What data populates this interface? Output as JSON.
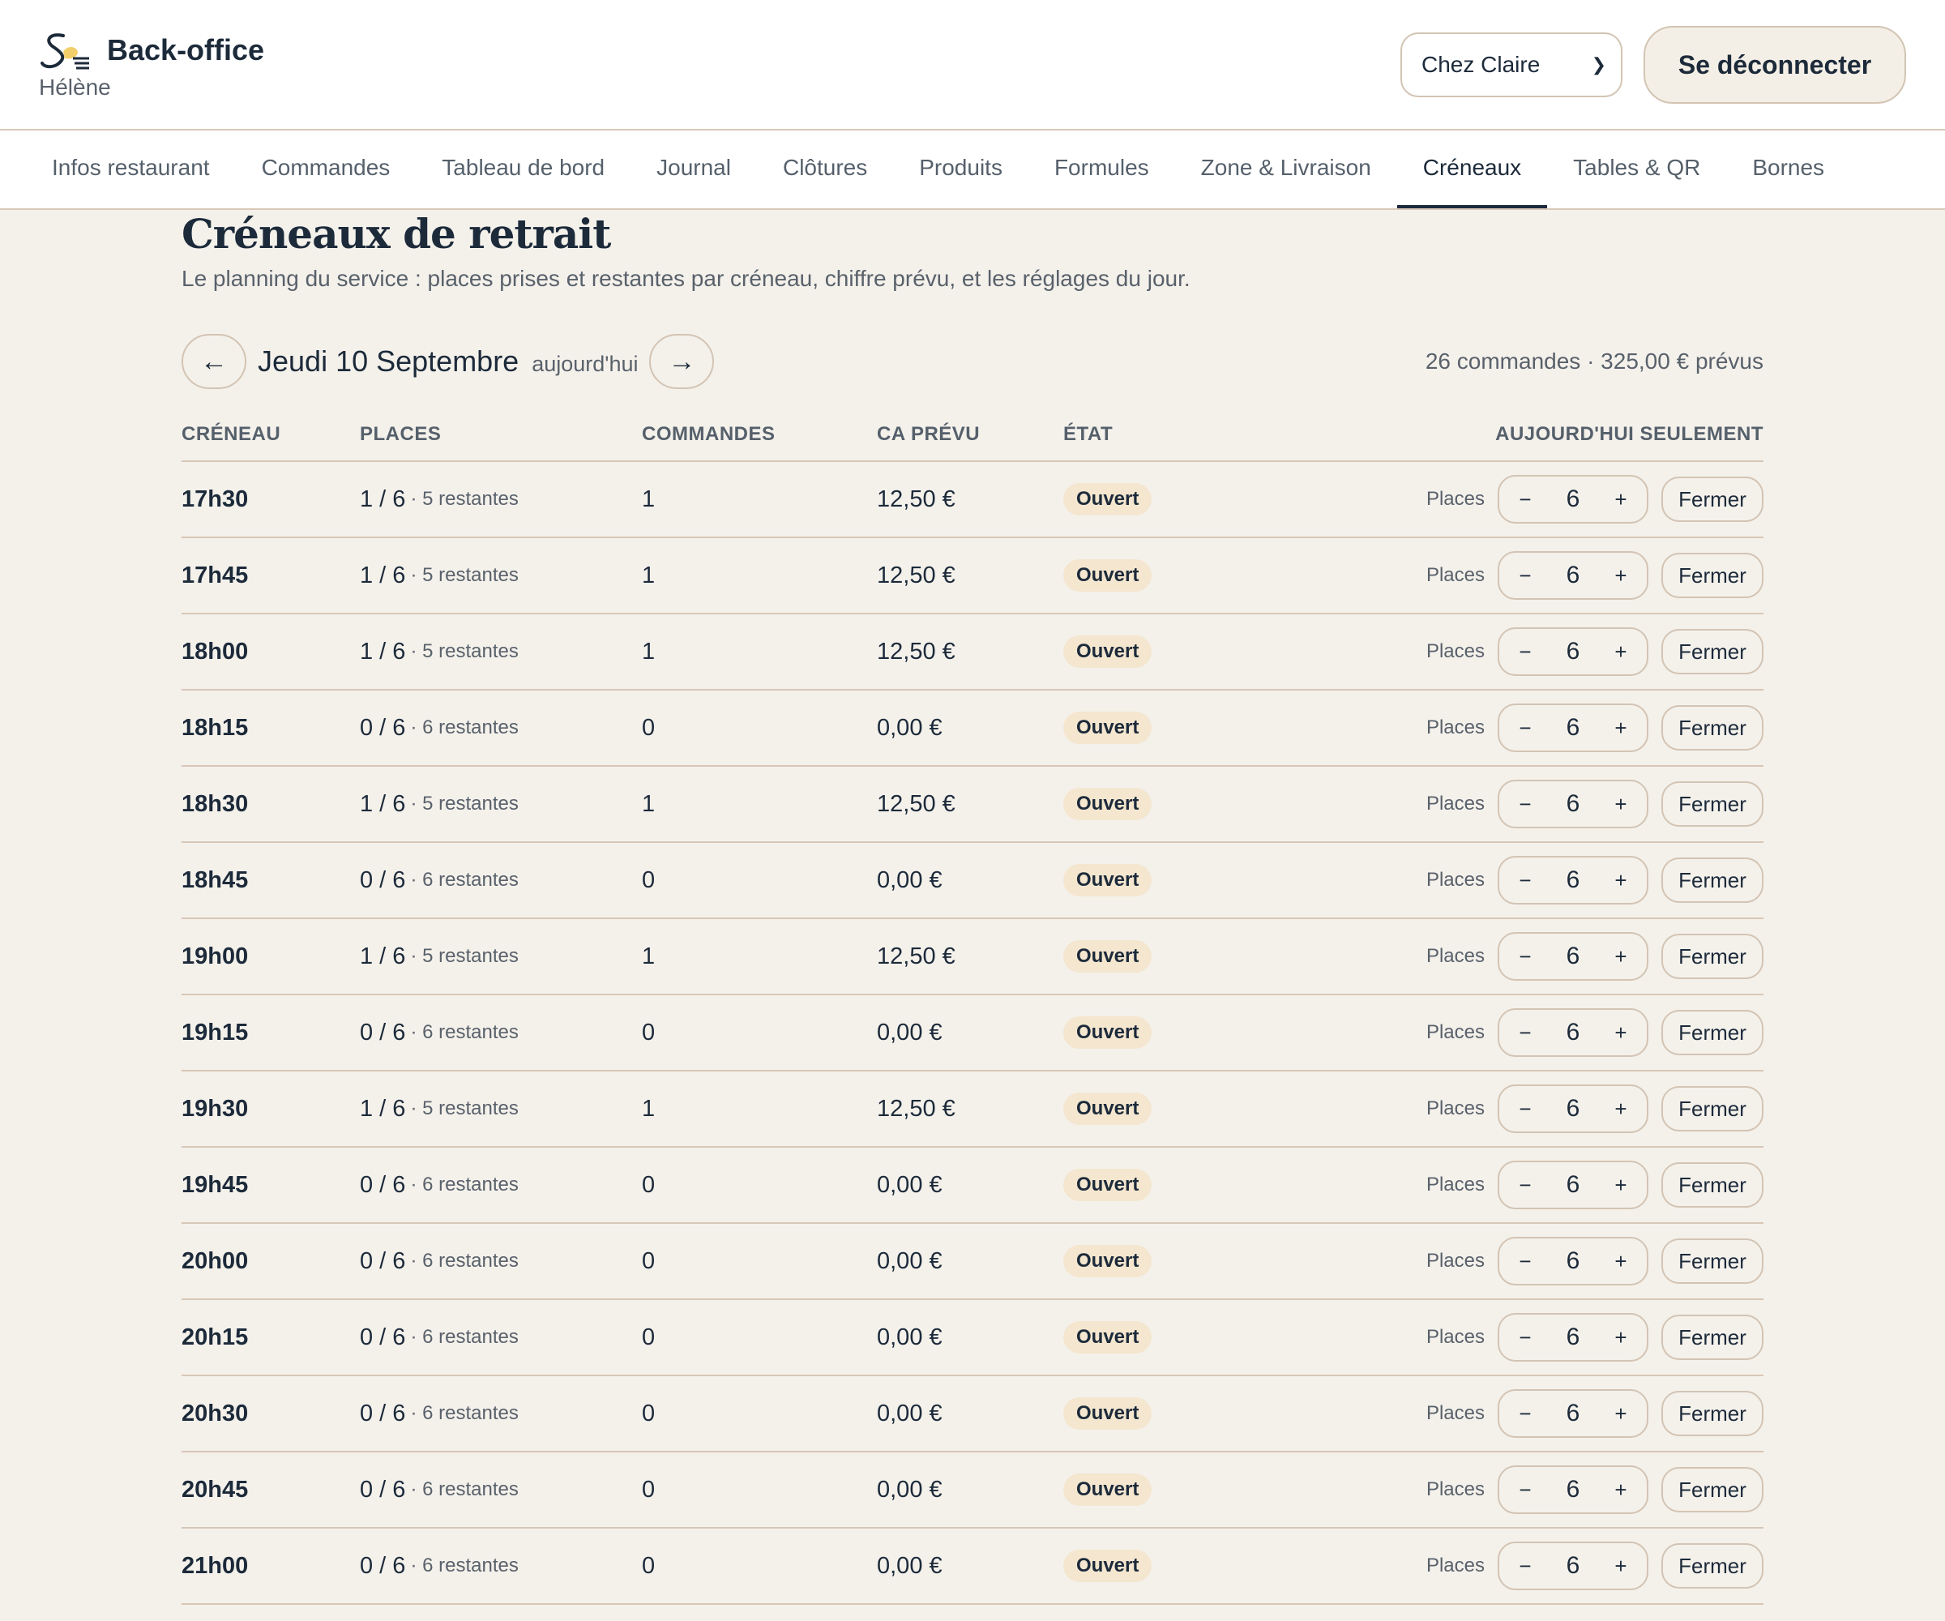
{
  "header": {
    "title": "Back-office",
    "user": "Hélène",
    "restaurant_select": "Chez Claire",
    "logout_label": "Se déconnecter"
  },
  "nav": {
    "tabs": [
      {
        "label": "Infos restaurant"
      },
      {
        "label": "Commandes"
      },
      {
        "label": "Tableau de bord"
      },
      {
        "label": "Journal"
      },
      {
        "label": "Clôtures"
      },
      {
        "label": "Produits"
      },
      {
        "label": "Formules"
      },
      {
        "label": "Zone & Livraison"
      },
      {
        "label": "Créneaux",
        "active": true
      },
      {
        "label": "Tables & QR"
      },
      {
        "label": "Bornes"
      }
    ]
  },
  "page": {
    "title": "Créneaux de retrait",
    "subtitle": "Le planning du service : places prises et restantes par créneau, chiffre prévu, et les réglages du jour.",
    "prev_icon": "←",
    "next_icon": "→",
    "date": "Jeudi 10 Septembre",
    "today": "aujourd'hui",
    "summary": "26 commandes · 325,00 € prévus"
  },
  "table": {
    "headers": {
      "slot": "CRÉNEAU",
      "places": "PLACES",
      "orders": "COMMANDES",
      "revenue": "CA PRÉVU",
      "state": "ÉTAT",
      "today_only": "AUJOURD'HUI SEULEMENT"
    },
    "places_label": "Places",
    "minus": "−",
    "plus": "+",
    "close_label": "Fermer",
    "rows": [
      {
        "slot": "17h30",
        "places": "1 / 6",
        "remaining": "· 5 restantes",
        "orders": "1",
        "revenue": "12,50 €",
        "state": "Ouvert",
        "capacity": "6"
      },
      {
        "slot": "17h45",
        "places": "1 / 6",
        "remaining": "· 5 restantes",
        "orders": "1",
        "revenue": "12,50 €",
        "state": "Ouvert",
        "capacity": "6"
      },
      {
        "slot": "18h00",
        "places": "1 / 6",
        "remaining": "· 5 restantes",
        "orders": "1",
        "revenue": "12,50 €",
        "state": "Ouvert",
        "capacity": "6"
      },
      {
        "slot": "18h15",
        "places": "0 / 6",
        "remaining": "· 6 restantes",
        "orders": "0",
        "revenue": "0,00 €",
        "state": "Ouvert",
        "capacity": "6"
      },
      {
        "slot": "18h30",
        "places": "1 / 6",
        "remaining": "· 5 restantes",
        "orders": "1",
        "revenue": "12,50 €",
        "state": "Ouvert",
        "capacity": "6"
      },
      {
        "slot": "18h45",
        "places": "0 / 6",
        "remaining": "· 6 restantes",
        "orders": "0",
        "revenue": "0,00 €",
        "state": "Ouvert",
        "capacity": "6"
      },
      {
        "slot": "19h00",
        "places": "1 / 6",
        "remaining": "· 5 restantes",
        "orders": "1",
        "revenue": "12,50 €",
        "state": "Ouvert",
        "capacity": "6"
      },
      {
        "slot": "19h15",
        "places": "0 / 6",
        "remaining": "· 6 restantes",
        "orders": "0",
        "revenue": "0,00 €",
        "state": "Ouvert",
        "capacity": "6"
      },
      {
        "slot": "19h30",
        "places": "1 / 6",
        "remaining": "· 5 restantes",
        "orders": "1",
        "revenue": "12,50 €",
        "state": "Ouvert",
        "capacity": "6"
      },
      {
        "slot": "19h45",
        "places": "0 / 6",
        "remaining": "· 6 restantes",
        "orders": "0",
        "revenue": "0,00 €",
        "state": "Ouvert",
        "capacity": "6"
      },
      {
        "slot": "20h00",
        "places": "0 / 6",
        "remaining": "· 6 restantes",
        "orders": "0",
        "revenue": "0,00 €",
        "state": "Ouvert",
        "capacity": "6"
      },
      {
        "slot": "20h15",
        "places": "0 / 6",
        "remaining": "· 6 restantes",
        "orders": "0",
        "revenue": "0,00 €",
        "state": "Ouvert",
        "capacity": "6"
      },
      {
        "slot": "20h30",
        "places": "0 / 6",
        "remaining": "· 6 restantes",
        "orders": "0",
        "revenue": "0,00 €",
        "state": "Ouvert",
        "capacity": "6"
      },
      {
        "slot": "20h45",
        "places": "0 / 6",
        "remaining": "· 6 restantes",
        "orders": "0",
        "revenue": "0,00 €",
        "state": "Ouvert",
        "capacity": "6"
      },
      {
        "slot": "21h00",
        "places": "0 / 6",
        "remaining": "· 6 restantes",
        "orders": "0",
        "revenue": "0,00 €",
        "state": "Ouvert",
        "capacity": "6"
      }
    ]
  },
  "colors": {
    "background": "#f4f1eb",
    "text": "#1c2a3a",
    "muted": "#59616b",
    "border": "#d8c7b6",
    "badge": "#f4e6cf",
    "logo_accent": "#f2cf6b"
  },
  "icons": {
    "logo": "brand-logo-icon",
    "select": "chevron-down-icon",
    "prev": "arrow-left-icon",
    "next": "arrow-right-icon"
  }
}
